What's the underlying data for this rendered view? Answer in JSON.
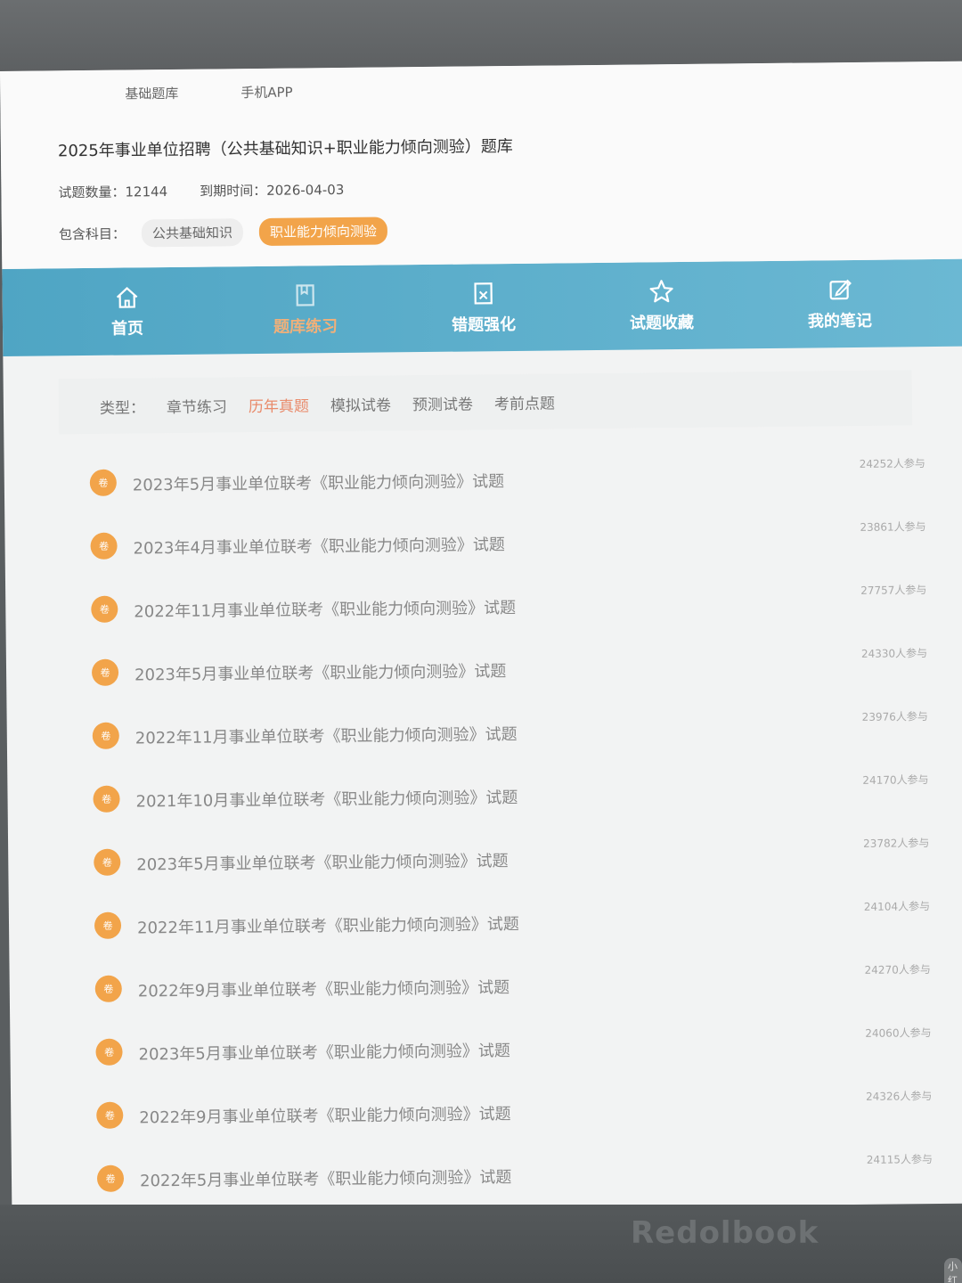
{
  "topnav": [
    "基础题库",
    "手机APP"
  ],
  "bank": {
    "title": "2025年事业单位招聘（公共基础知识+职业能力倾向测验）题库",
    "count_label": "试题数量：",
    "count": "12144",
    "expire_label": "到期时间：",
    "expire": "2026-04-03",
    "subjects_label": "包含科目：",
    "subjects": [
      "公共基础知识",
      "职业能力倾向测验"
    ],
    "active_subject": 1
  },
  "mainnav": [
    {
      "label": "首页",
      "icon": "home-icon"
    },
    {
      "label": "题库练习",
      "icon": "book-icon"
    },
    {
      "label": "错题强化",
      "icon": "wrong-icon"
    },
    {
      "label": "试题收藏",
      "icon": "star-icon"
    },
    {
      "label": "我的笔记",
      "icon": "edit-icon"
    }
  ],
  "active_nav": 1,
  "filter": {
    "label": "类型：",
    "tabs": [
      "章节练习",
      "历年真题",
      "模拟试卷",
      "预测试卷",
      "考前点题"
    ],
    "active": 1
  },
  "badge_text": "卷",
  "papers": [
    {
      "title": "2023年5月事业单位联考《职业能力倾向测验》试题",
      "count": "24252人参与"
    },
    {
      "title": "2023年4月事业单位联考《职业能力倾向测验》试题",
      "count": "23861人参与"
    },
    {
      "title": "2022年11月事业单位联考《职业能力倾向测验》试题",
      "count": "27757人参与"
    },
    {
      "title": "2023年5月事业单位联考《职业能力倾向测验》试题",
      "count": "24330人参与"
    },
    {
      "title": "2022年11月事业单位联考《职业能力倾向测验》试题",
      "count": "23976人参与"
    },
    {
      "title": "2021年10月事业单位联考《职业能力倾向测验》试题",
      "count": "24170人参与"
    },
    {
      "title": "2023年5月事业单位联考《职业能力倾向测验》试题",
      "count": "23782人参与"
    },
    {
      "title": "2022年11月事业单位联考《职业能力倾向测验》试题",
      "count": "24104人参与"
    },
    {
      "title": "2022年9月事业单位联考《职业能力倾向测验》试题",
      "count": "24270人参与"
    },
    {
      "title": "2023年5月事业单位联考《职业能力倾向测验》试题",
      "count": "24060人参与"
    },
    {
      "title": "2022年9月事业单位联考《职业能力倾向测验》试题",
      "count": "24326人参与"
    },
    {
      "title": "2022年5月事业单位联考《职业能力倾向测验》试题",
      "count": "24115人参与"
    }
  ],
  "device_brand": "Redolbook",
  "corner_tag": "小红书"
}
